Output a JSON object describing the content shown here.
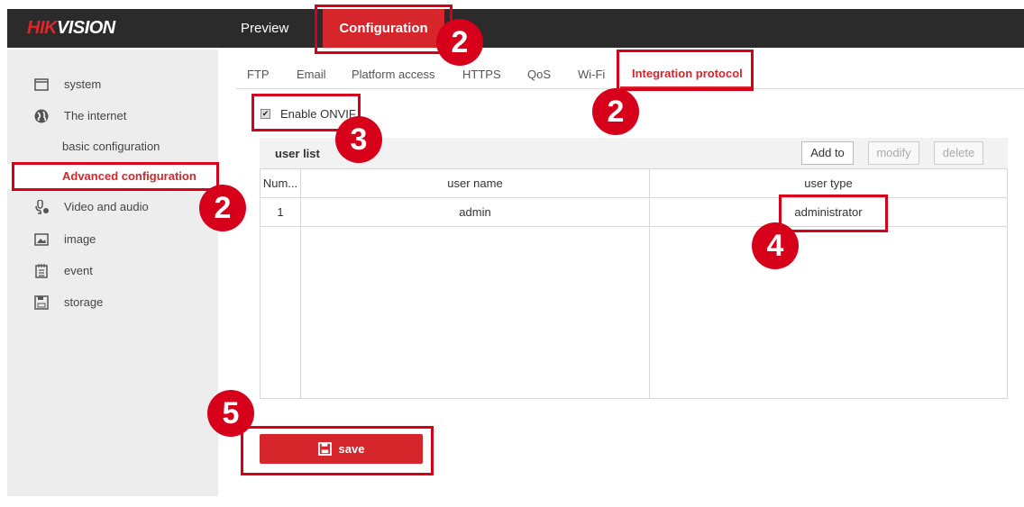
{
  "header": {
    "logo": "HIKVISION",
    "logo_red": "HIK",
    "logo_white": "VISION",
    "nav": [
      {
        "label": "Preview"
      },
      {
        "label": "Configuration",
        "active": true
      }
    ]
  },
  "sidebar": {
    "items": [
      {
        "label": "system",
        "icon": "window-icon"
      },
      {
        "label": "The internet",
        "icon": "globe-icon"
      },
      {
        "label": "basic configuration"
      },
      {
        "label": "Advanced configuration",
        "active": true
      },
      {
        "label": "Video and audio",
        "icon": "mic-icon"
      },
      {
        "label": "image",
        "icon": "image-icon"
      },
      {
        "label": "event",
        "icon": "calendar-icon"
      },
      {
        "label": "storage",
        "icon": "floppy-icon"
      }
    ]
  },
  "tabs": [
    "FTP",
    "Email",
    "Platform access",
    "HTTPS",
    "QoS",
    "Wi-Fi",
    "Integration protocol"
  ],
  "active_tab": "Integration protocol",
  "onvif": {
    "label": "Enable ONVIF",
    "checked": true
  },
  "userlist": {
    "title": "user list",
    "buttons": {
      "add": "Add to",
      "modify": "modify",
      "delete": "delete"
    },
    "columns": [
      "Num...",
      "user name",
      "user type"
    ],
    "rows": [
      {
        "num": "1",
        "name": "admin",
        "type": "administrator"
      }
    ]
  },
  "save_label": "save",
  "annotations": {
    "step2": "2",
    "step3": "3",
    "step4": "4",
    "step5": "5"
  },
  "colors": {
    "accent": "#d7262b",
    "header": "#2b2b2b",
    "annotation": "#d7001a"
  }
}
